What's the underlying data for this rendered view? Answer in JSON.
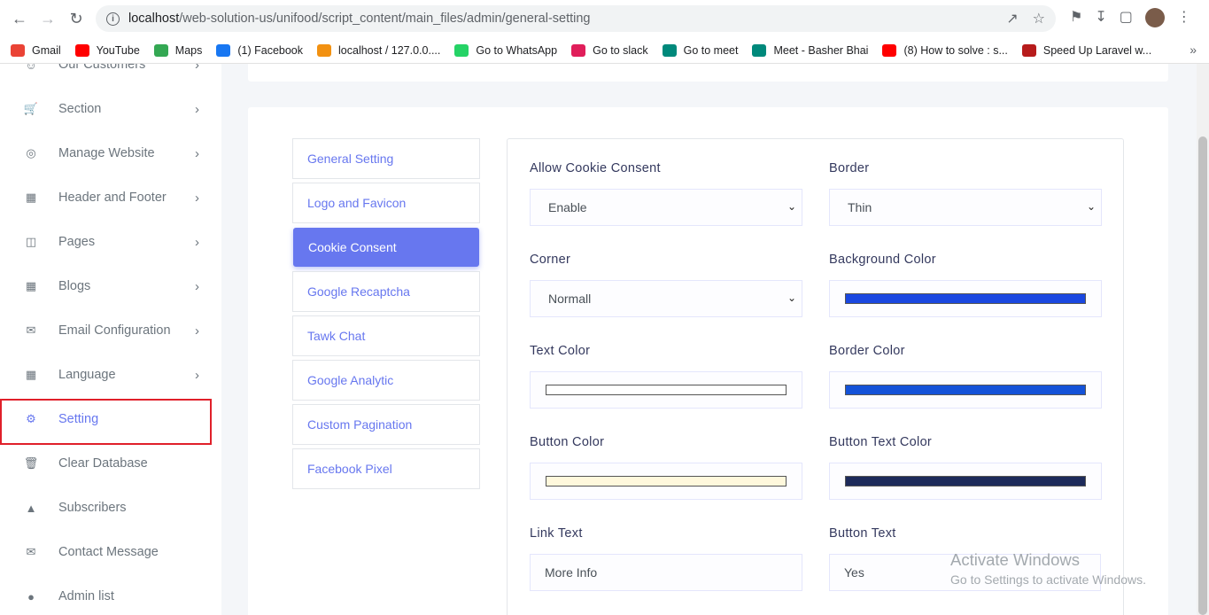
{
  "browser": {
    "url_host": "localhost",
    "url_path": "/web-solution-us/unifood/script_content/main_files/admin/general-setting",
    "bookmarks": [
      {
        "label": "Gmail",
        "color": "#ea4335"
      },
      {
        "label": "YouTube",
        "color": "#ff0000"
      },
      {
        "label": "Maps",
        "color": "#34a853"
      },
      {
        "label": "(1) Facebook",
        "color": "#1877f2"
      },
      {
        "label": "localhost / 127.0.0....",
        "color": "#f29111"
      },
      {
        "label": "Go to WhatsApp",
        "color": "#25d366"
      },
      {
        "label": "Go to slack",
        "color": "#e01e5a"
      },
      {
        "label": "Go to meet",
        "color": "#00897b"
      },
      {
        "label": "Meet - Basher Bhai",
        "color": "#00897b"
      },
      {
        "label": "(8) How to solve : s...",
        "color": "#ff0000"
      },
      {
        "label": "Speed Up Laravel w...",
        "color": "#b71c1c"
      }
    ]
  },
  "sidebar": {
    "items": [
      {
        "label": "Our Customers",
        "icon": "users-icon",
        "chevron": true
      },
      {
        "label": "Section",
        "icon": "cart-icon",
        "chevron": true
      },
      {
        "label": "Manage Website",
        "icon": "globe-icon",
        "chevron": true
      },
      {
        "label": "Header and Footer",
        "icon": "grid-icon",
        "chevron": true
      },
      {
        "label": "Pages",
        "icon": "columns-icon",
        "chevron": true
      },
      {
        "label": "Blogs",
        "icon": "grid-icon",
        "chevron": true
      },
      {
        "label": "Email Configuration",
        "icon": "envelope-icon",
        "chevron": true
      },
      {
        "label": "Language",
        "icon": "grid-icon",
        "chevron": true
      },
      {
        "label": "Setting",
        "icon": "gear-icon",
        "chevron": false,
        "active": true
      },
      {
        "label": "Clear Database",
        "icon": "trash-icon",
        "chevron": false
      },
      {
        "label": "Subscribers",
        "icon": "fire-icon",
        "chevron": false
      },
      {
        "label": "Contact Message",
        "icon": "envelope-icon",
        "chevron": false
      },
      {
        "label": "Admin list",
        "icon": "user-icon",
        "chevron": false
      }
    ]
  },
  "tabs": [
    {
      "label": "General Setting"
    },
    {
      "label": "Logo and Favicon"
    },
    {
      "label": "Cookie Consent",
      "active": true
    },
    {
      "label": "Google Recaptcha"
    },
    {
      "label": "Tawk Chat"
    },
    {
      "label": "Google Analytic"
    },
    {
      "label": "Custom Pagination"
    },
    {
      "label": "Facebook Pixel"
    }
  ],
  "form": {
    "allow_cookie_consent": {
      "label": "Allow Cookie Consent",
      "value": "Enable"
    },
    "border": {
      "label": "Border",
      "value": "Thin"
    },
    "corner": {
      "label": "Corner",
      "value": "Normall"
    },
    "background_color": {
      "label": "Background Color",
      "color": "#1a47e0"
    },
    "text_color": {
      "label": "Text Color",
      "color": "#ffffff"
    },
    "border_color": {
      "label": "Border Color",
      "color": "#1452d8"
    },
    "button_color": {
      "label": "Button Color",
      "color": "#fff8dc"
    },
    "button_text_color": {
      "label": "Button Text Color",
      "color": "#1d2a5a"
    },
    "link_text": {
      "label": "Link Text",
      "value": "More Info"
    },
    "button_text": {
      "label": "Button Text",
      "value": "Yes"
    }
  },
  "watermark": {
    "line1": "Activate Windows",
    "line2": "Go to Settings to activate Windows."
  }
}
